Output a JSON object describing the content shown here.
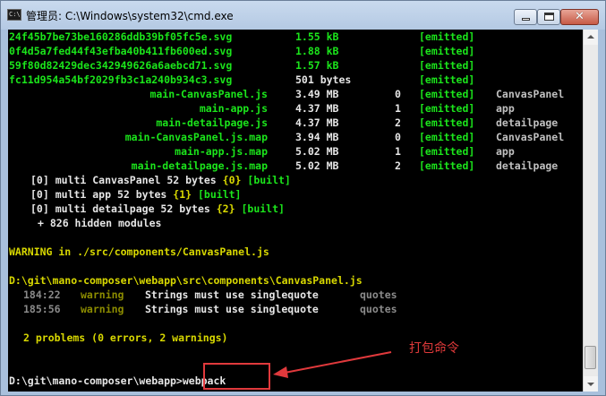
{
  "window": {
    "title": "管理员: C:\\Windows\\system32\\cmd.exe",
    "app_icon_text": "C:\\"
  },
  "controls": {
    "minimize": "minimize",
    "maximize": "maximize",
    "close": "✕"
  },
  "assets": [
    {
      "name": "24f45b7be73be160286ddb39bf05fc5e.svg",
      "size": "1.55 kB",
      "chunks": "",
      "status": "[emitted]",
      "chunk_names": ""
    },
    {
      "name": "0f4d5a7fed44f43efba40b411fb600ed.svg",
      "size": "1.88 kB",
      "chunks": "",
      "status": "[emitted]",
      "chunk_names": ""
    },
    {
      "name": "59f80d82429dec342949626a6aebcd71.svg",
      "size": "1.57 kB",
      "chunks": "",
      "status": "[emitted]",
      "chunk_names": ""
    },
    {
      "name": "fc11d954a54bf2029fb3c1a240b934c3.svg",
      "size": "501 bytes",
      "chunks": "",
      "status": "[emitted]",
      "chunk_names": ""
    },
    {
      "name": "main-CanvasPanel.js",
      "size": "3.49 MB",
      "chunks": "0",
      "status": "[emitted]",
      "chunk_names": "CanvasPanel"
    },
    {
      "name": "main-app.js",
      "size": "4.37 MB",
      "chunks": "1",
      "status": "[emitted]",
      "chunk_names": "app"
    },
    {
      "name": "main-detailpage.js",
      "size": "4.37 MB",
      "chunks": "2",
      "status": "[emitted]",
      "chunk_names": "detailpage"
    },
    {
      "name": "main-CanvasPanel.js.map",
      "size": "3.94 MB",
      "chunks": "0",
      "status": "[emitted]",
      "chunk_names": "CanvasPanel"
    },
    {
      "name": "main-app.js.map",
      "size": "5.02 MB",
      "chunks": "1",
      "status": "[emitted]",
      "chunk_names": "app"
    },
    {
      "name": "main-detailpage.js.map",
      "size": "5.02 MB",
      "chunks": "2",
      "status": "[emitted]",
      "chunk_names": "detailpage"
    }
  ],
  "modules": [
    {
      "id": "[0]",
      "desc": "multi CanvasPanel 52 bytes",
      "chunk": "{0}",
      "status": "[built]"
    },
    {
      "id": "[0]",
      "desc": "multi app 52 bytes",
      "chunk": "{1}",
      "status": "[built]"
    },
    {
      "id": "[0]",
      "desc": "multi detailpage 52 bytes",
      "chunk": "{2}",
      "status": "[built]"
    }
  ],
  "hidden_modules": "+ 826 hidden modules",
  "warning_header": "WARNING in ./src/components/CanvasPanel.js",
  "warning_path": "D:\\git\\mano-composer\\webapp\\src\\components\\CanvasPanel.js",
  "problems": [
    {
      "loc": "184:22",
      "level": "warning",
      "message": "Strings must use singlequote",
      "rule": "quotes"
    },
    {
      "loc": "185:56",
      "level": "warning",
      "message": "Strings must use singlequote",
      "rule": "quotes"
    }
  ],
  "summary": "2 problems (0 errors, 2 warnings)",
  "prompt": "D:\\git\\mano-composer\\webapp>webpack",
  "annotation": "打包命令",
  "colors": {
    "green": "#1be51b",
    "yellow": "#d8d800",
    "highlight": "#e0393c"
  }
}
